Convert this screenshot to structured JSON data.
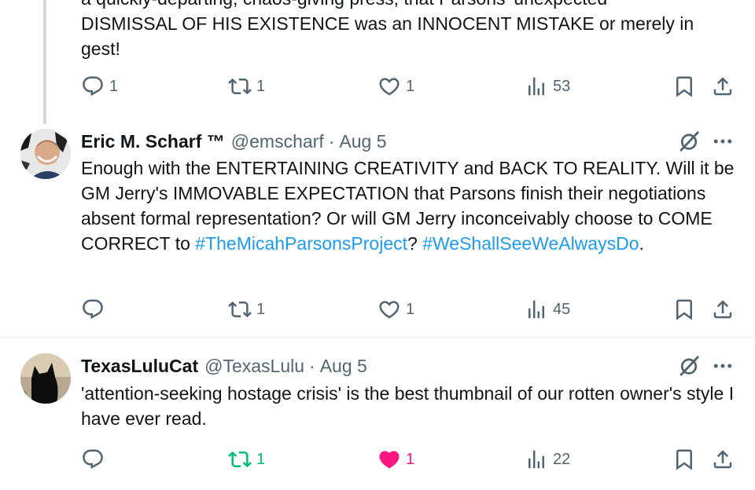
{
  "tweet_top": {
    "text_line1": "a quickly-departing, chaos-giving press, that Parsons' unexpected",
    "text_line2": "DISMISSAL OF HIS EXISTENCE was an INNOCENT MISTAKE or merely in",
    "text_line3": "gest!",
    "replies": "1",
    "retweets": "1",
    "likes": "1",
    "views": "53"
  },
  "tweet_eric": {
    "name": "Eric M. Scharf ™",
    "handle": "@emscharf",
    "separator": "·",
    "date": "Aug 5",
    "text_part1": "Enough with the ENTERTAINING CREATIVITY and BACK TO REALITY. Will it be GM Jerry's IMMOVABLE EXPECTATION that Parsons finish their negotiations absent formal representation? Or will GM Jerry inconceivably choose to COME CORRECT to ",
    "hashtag1": "#TheMicahParsonsProject",
    "text_part2": "? ",
    "hashtag2": "#WeShallSeeWeAlwaysDo",
    "text_part3": ".",
    "replies": "",
    "retweets": "1",
    "likes": "1",
    "views": "45"
  },
  "tweet_lulu": {
    "name": "TexasLuluCat",
    "handle": "@TexasLulu",
    "separator": "·",
    "date": "Aug 5",
    "text": "'attention-seeking hostage crisis' is the best thumbnail of our rotten owner's style I have ever read.",
    "replies": "",
    "retweets": "1",
    "likes": "1",
    "views": "22",
    "retweeted": true,
    "liked": true
  },
  "colors": {
    "text": "#0f1419",
    "muted": "#536471",
    "link": "#1d9bf0",
    "retweet_active": "#00ba7c",
    "like_active": "#f91880",
    "thread_line": "#cfd9de"
  },
  "icons": [
    "reply-icon",
    "retweet-icon",
    "like-icon",
    "views-icon",
    "bookmark-icon",
    "share-icon",
    "grok-icon",
    "more-icon"
  ]
}
